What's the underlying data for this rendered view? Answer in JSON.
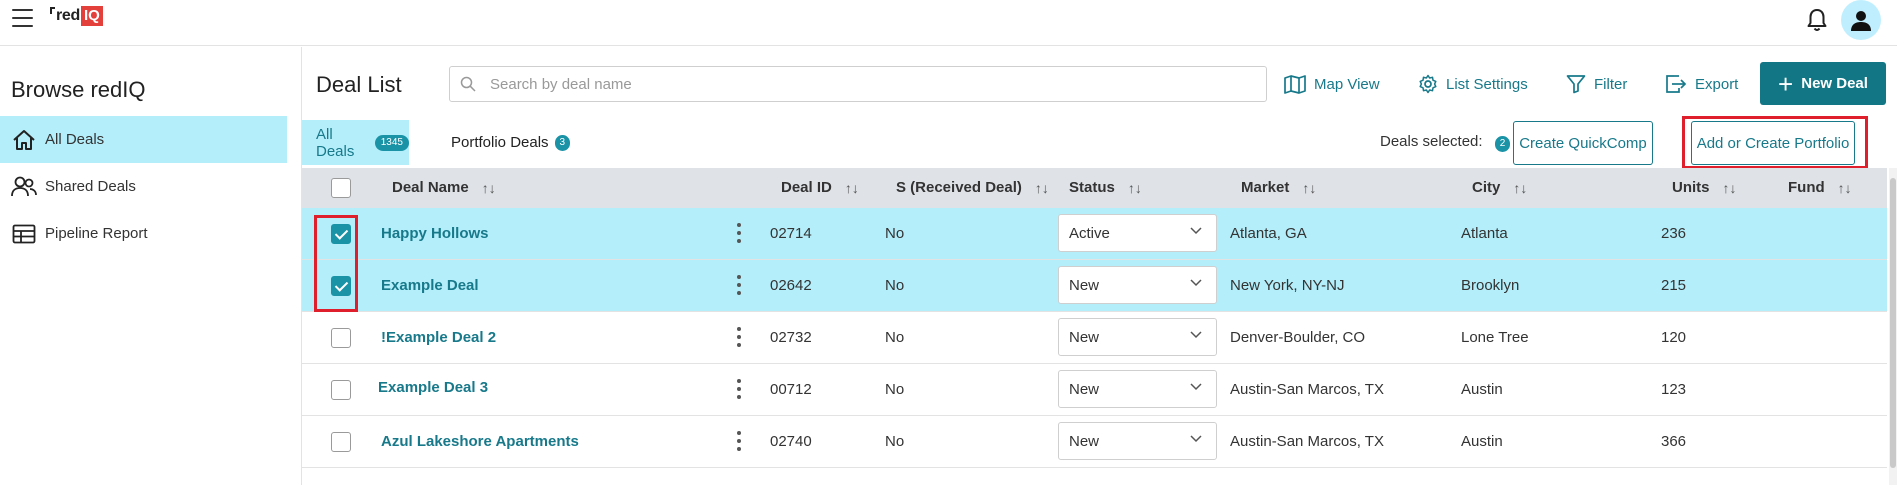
{
  "app": {
    "logo_text": "red",
    "logo_badge": "IQ"
  },
  "sidebar": {
    "title": "Browse redIQ",
    "items": [
      {
        "label": "All Deals",
        "icon": "home-icon",
        "active": true
      },
      {
        "label": "Shared Deals",
        "icon": "users-icon",
        "active": false
      },
      {
        "label": "Pipeline Report",
        "icon": "table-icon",
        "active": false
      }
    ]
  },
  "header": {
    "title": "Deal List",
    "search_placeholder": "Search by deal name",
    "tools": {
      "map_view": "Map View",
      "list_settings": "List Settings",
      "filter": "Filter",
      "export": "Export"
    },
    "new_deal": "New Deal"
  },
  "tabs": {
    "all_deals": {
      "label": "All Deals",
      "count": "1345"
    },
    "portfolio_deals": {
      "label": "Portfolio Deals",
      "count": "3"
    }
  },
  "selection": {
    "label": "Deals selected:",
    "count": "2",
    "create_quickcomp": "Create QuickComp",
    "add_or_create_portfolio": "Add or Create Portfolio"
  },
  "table": {
    "columns": {
      "deal_name": "Deal Name",
      "deal_id": "Deal ID",
      "received": "S (Received Deal)",
      "status": "Status",
      "market": "Market",
      "city": "City",
      "units": "Units",
      "fund": "Fund"
    },
    "sort_glyph": "↑↓",
    "rows": [
      {
        "name": "Happy Hollows",
        "id": "02714",
        "received": "No",
        "status": "Active",
        "market": "Atlanta, GA",
        "city": "Atlanta",
        "units": "236",
        "selected": true
      },
      {
        "name": "Example Deal",
        "id": "02642",
        "received": "No",
        "status": "New",
        "market": "New York, NY-NJ",
        "city": "Brooklyn",
        "units": "215",
        "selected": true
      },
      {
        "name": "!Example Deal 2",
        "id": "02732",
        "received": "No",
        "status": "New",
        "market": "Denver-Boulder, CO",
        "city": "Lone Tree",
        "units": "120",
        "selected": false
      },
      {
        "name": "Example Deal 3",
        "id": "00712",
        "received": "No",
        "status": "New",
        "market": "Austin-San Marcos, TX",
        "city": "Austin",
        "units": "123",
        "selected": false
      },
      {
        "name": "Azul Lakeshore Apartments",
        "id": "02740",
        "received": "No",
        "status": "New",
        "market": "Austin-San Marcos, TX",
        "city": "Austin",
        "units": "366",
        "selected": false
      }
    ]
  },
  "colors": {
    "accent": "#17798a",
    "selected_row": "#b3eefa",
    "highlight": "#e01f2d"
  }
}
